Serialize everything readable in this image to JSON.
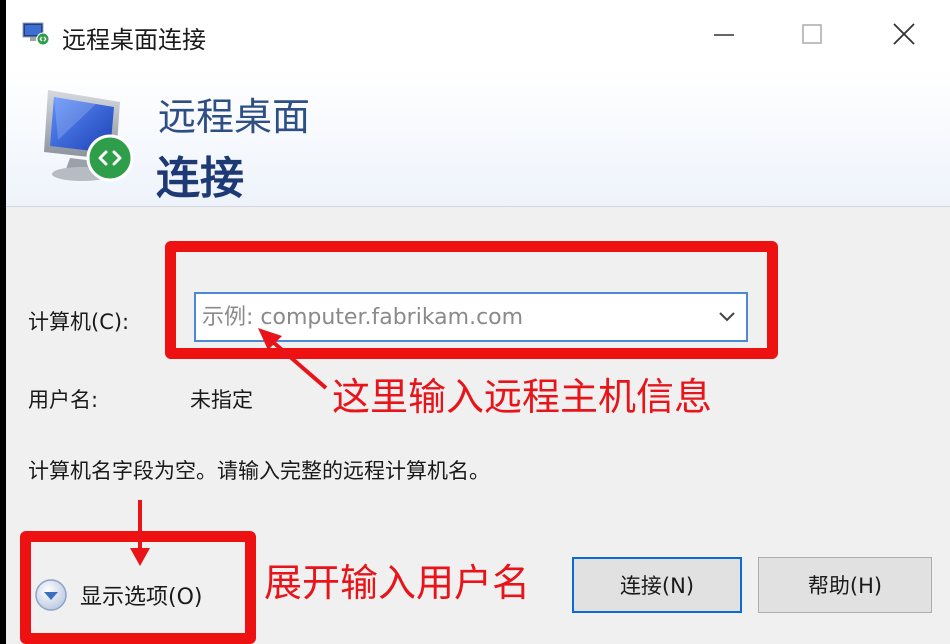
{
  "window": {
    "title": "远程桌面连接"
  },
  "banner": {
    "line1": "远程桌面",
    "line2": "连接"
  },
  "form": {
    "computer_label": "计算机(C):",
    "computer_placeholder": "示例: computer.fabrikam.com",
    "computer_value": "",
    "username_label": "用户名:",
    "username_value": "未指定",
    "message": "计算机名字段为空。请输入完整的远程计算机名。"
  },
  "annotations": {
    "computer_hint": "这里输入远程主机信息",
    "options_hint": "展开输入用户名",
    "color": "#e8141a"
  },
  "footer": {
    "show_options_label": "显示选项(O)",
    "connect_label": "连接(N)",
    "help_label": "帮助(H)"
  },
  "icons": {
    "app": "remote-desktop-icon",
    "banner": "monitor-remote-icon",
    "minimize": "minimize-icon",
    "maximize": "maximize-icon",
    "close": "close-icon",
    "dropdown": "chevron-down-icon",
    "expand": "expand-circle-icon"
  },
  "colors": {
    "accent": "#0a6ad6",
    "banner_title": "#2e4f86",
    "highlight": "#ee1111"
  }
}
